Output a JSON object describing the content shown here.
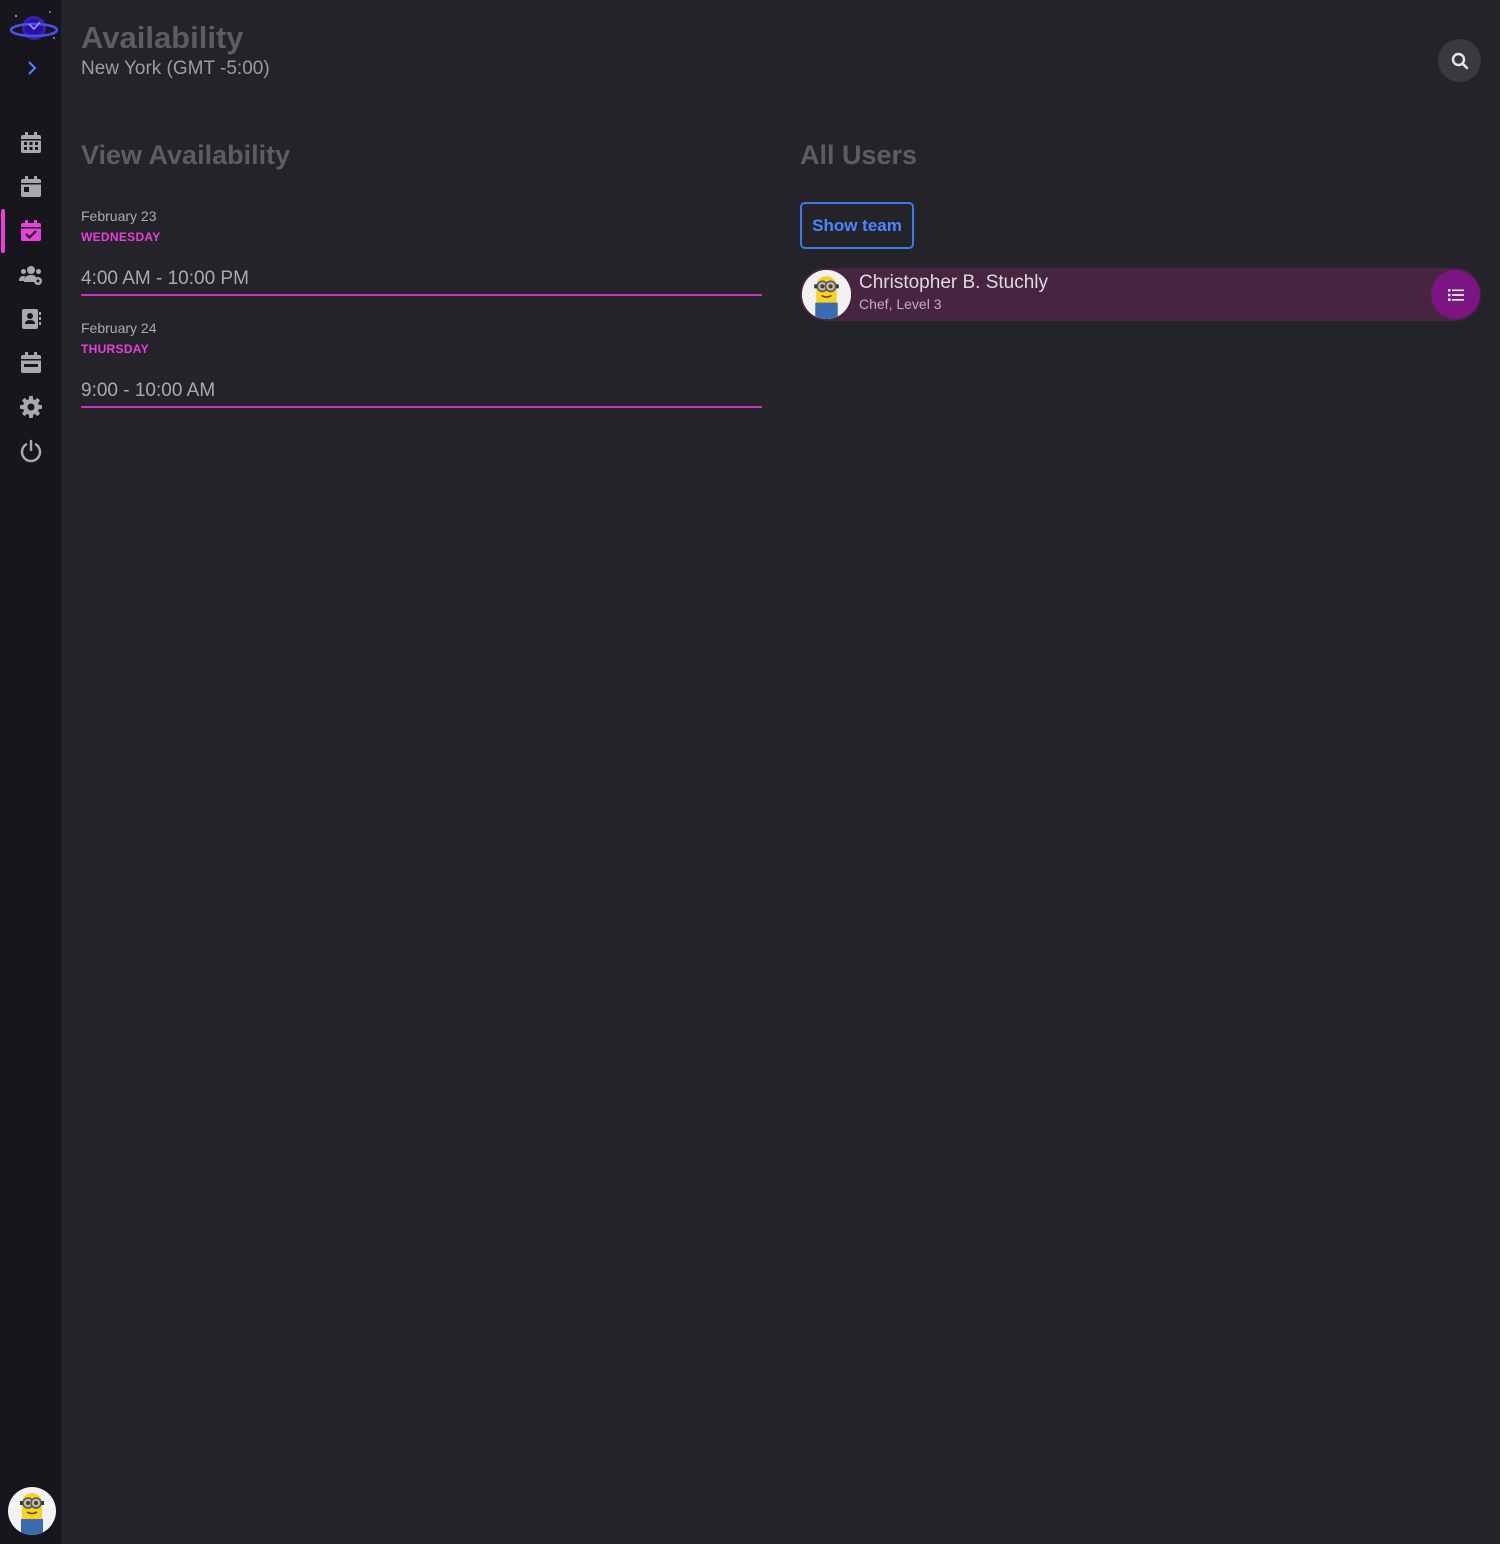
{
  "header": {
    "title": "Availability",
    "timezone": "New York (GMT -5:00)"
  },
  "sidebar": {
    "items": [
      {
        "icon": "calendar-grid-icon"
      },
      {
        "icon": "calendar-day-icon"
      },
      {
        "icon": "calendar-check-icon",
        "active": true
      },
      {
        "icon": "users-cog-icon"
      },
      {
        "icon": "contact-book-icon"
      },
      {
        "icon": "calendar-week-icon"
      },
      {
        "icon": "gear-icon"
      },
      {
        "icon": "power-icon"
      }
    ]
  },
  "availability": {
    "heading": "View Availability",
    "days": [
      {
        "date": "February 23",
        "weekday": "WEDNESDAY",
        "time": "4:00 AM - 10:00 PM"
      },
      {
        "date": "February 24",
        "weekday": "THURSDAY",
        "time": "9:00 - 10:00 AM"
      }
    ]
  },
  "users": {
    "heading": "All Users",
    "show_team_label": "Show team",
    "list": [
      {
        "name": "Christopher B. Stuchly",
        "role": "Chef, Level 3"
      }
    ]
  },
  "colors": {
    "accent": "#e840dd",
    "link": "#4a86ff",
    "row_bg": "#47243f"
  }
}
